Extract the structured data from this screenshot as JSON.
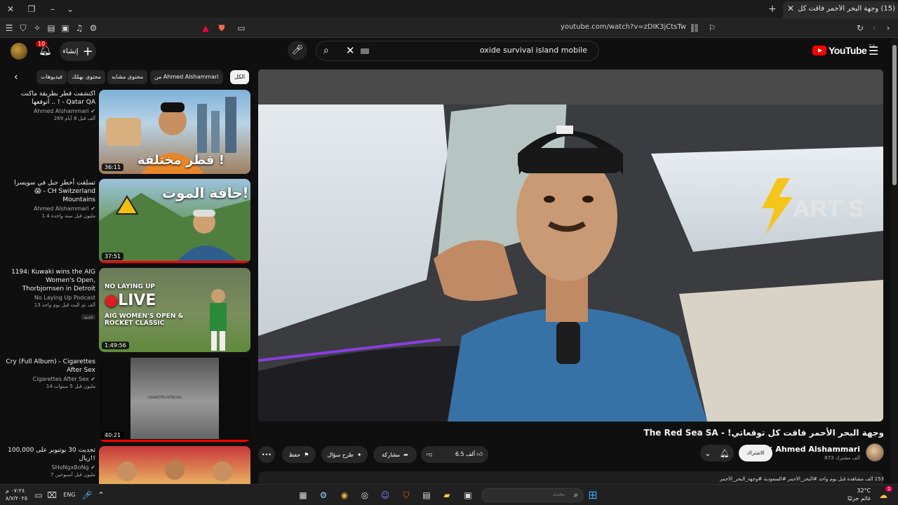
{
  "browser": {
    "tab_title": "(15) وجهة البحر الأحمر فاقت كل",
    "url": "youtube.com/watch?v=zDIK3jCtsTw"
  },
  "header": {
    "create_label": "إنشاء",
    "notif_count": "10",
    "search_value": "oxide survival island mobile",
    "logo_text": "YouTube",
    "logo_country": "SA"
  },
  "chips": [
    "الكل",
    "من Ahmed Alshammari",
    "محتوى مشابه",
    "محتوى بهمّك",
    "فيديوهات"
  ],
  "sidebar": [
    {
      "title": "اكتشفت قطر بطريقة ماكنت أتوقعها .. ! - Qatar QA",
      "channel": "Ahmed Alshammari",
      "stats": "269 ألف  قبل 8 أيام",
      "duration": "36:11",
      "overlay": "قطر مختلفة !"
    },
    {
      "title": "تسلقت أخطر جبل في سويسرا 😱 - CH Switzerland Mountains",
      "channel": "Ahmed Alshammari",
      "stats": "1.4 مليون  قبل سنة واحدة",
      "duration": "37:51",
      "overlay": "حافة الموت!"
    },
    {
      "title": "1194: Kuwaki wins the AIG Women's Open, Thorbjornsen in Detroit",
      "channel": "No Laying Up Podcast",
      "stats": "13 ألف  تم البث قبل يوم واحد",
      "badge": "جديد",
      "duration": "1:49:56",
      "overlay": "LIVE",
      "overlay_top": "NO LAYING UP",
      "overlay_sub": "AIG WOMEN'S OPEN & ROCKET CLASSIC"
    },
    {
      "title": "Cry (Full Album) - Cigarettes After Sex",
      "channel": "Cigarettes After Sex",
      "stats": "14 مليون  قبل 5 سنوات",
      "duration": "40:21",
      "overlay": "CIGARETTES AFTER SEX"
    },
    {
      "title": "تحديت 30 يوتيوبر على 100,000 ريال!!",
      "channel": "SHoNgxBoNg",
      "stats": "7 مليون  قبل أسبوعين",
      "duration": "",
      "overlay": ""
    }
  ],
  "video": {
    "title": "وجهة البحر الأحمر فاقت كل توقعاتي! - The Red Sea SA",
    "channel": "Ahmed Alshammari",
    "subs": "873 ألف مشترك",
    "subscribe_label": "الاشتراك",
    "likes": "6.5 ألف",
    "share_label": "مشاركة",
    "ask_label": "طرح سؤال",
    "save_label": "حفظ",
    "description": "153 ألف مشاهدة قبل يوم واحد  #البحر_الأحمر #السعودية #وجهة_البحر_الأحمر",
    "overlay_brand": "ART STORE"
  },
  "taskbar": {
    "search_placeholder": "بحث",
    "lang": "ENG",
    "time": "٠٧:٢٤ م",
    "date": "٨/٧/٢٠٢٥",
    "temp": "32°C",
    "weather": "غائم جزئيًا",
    "notif": "1"
  }
}
